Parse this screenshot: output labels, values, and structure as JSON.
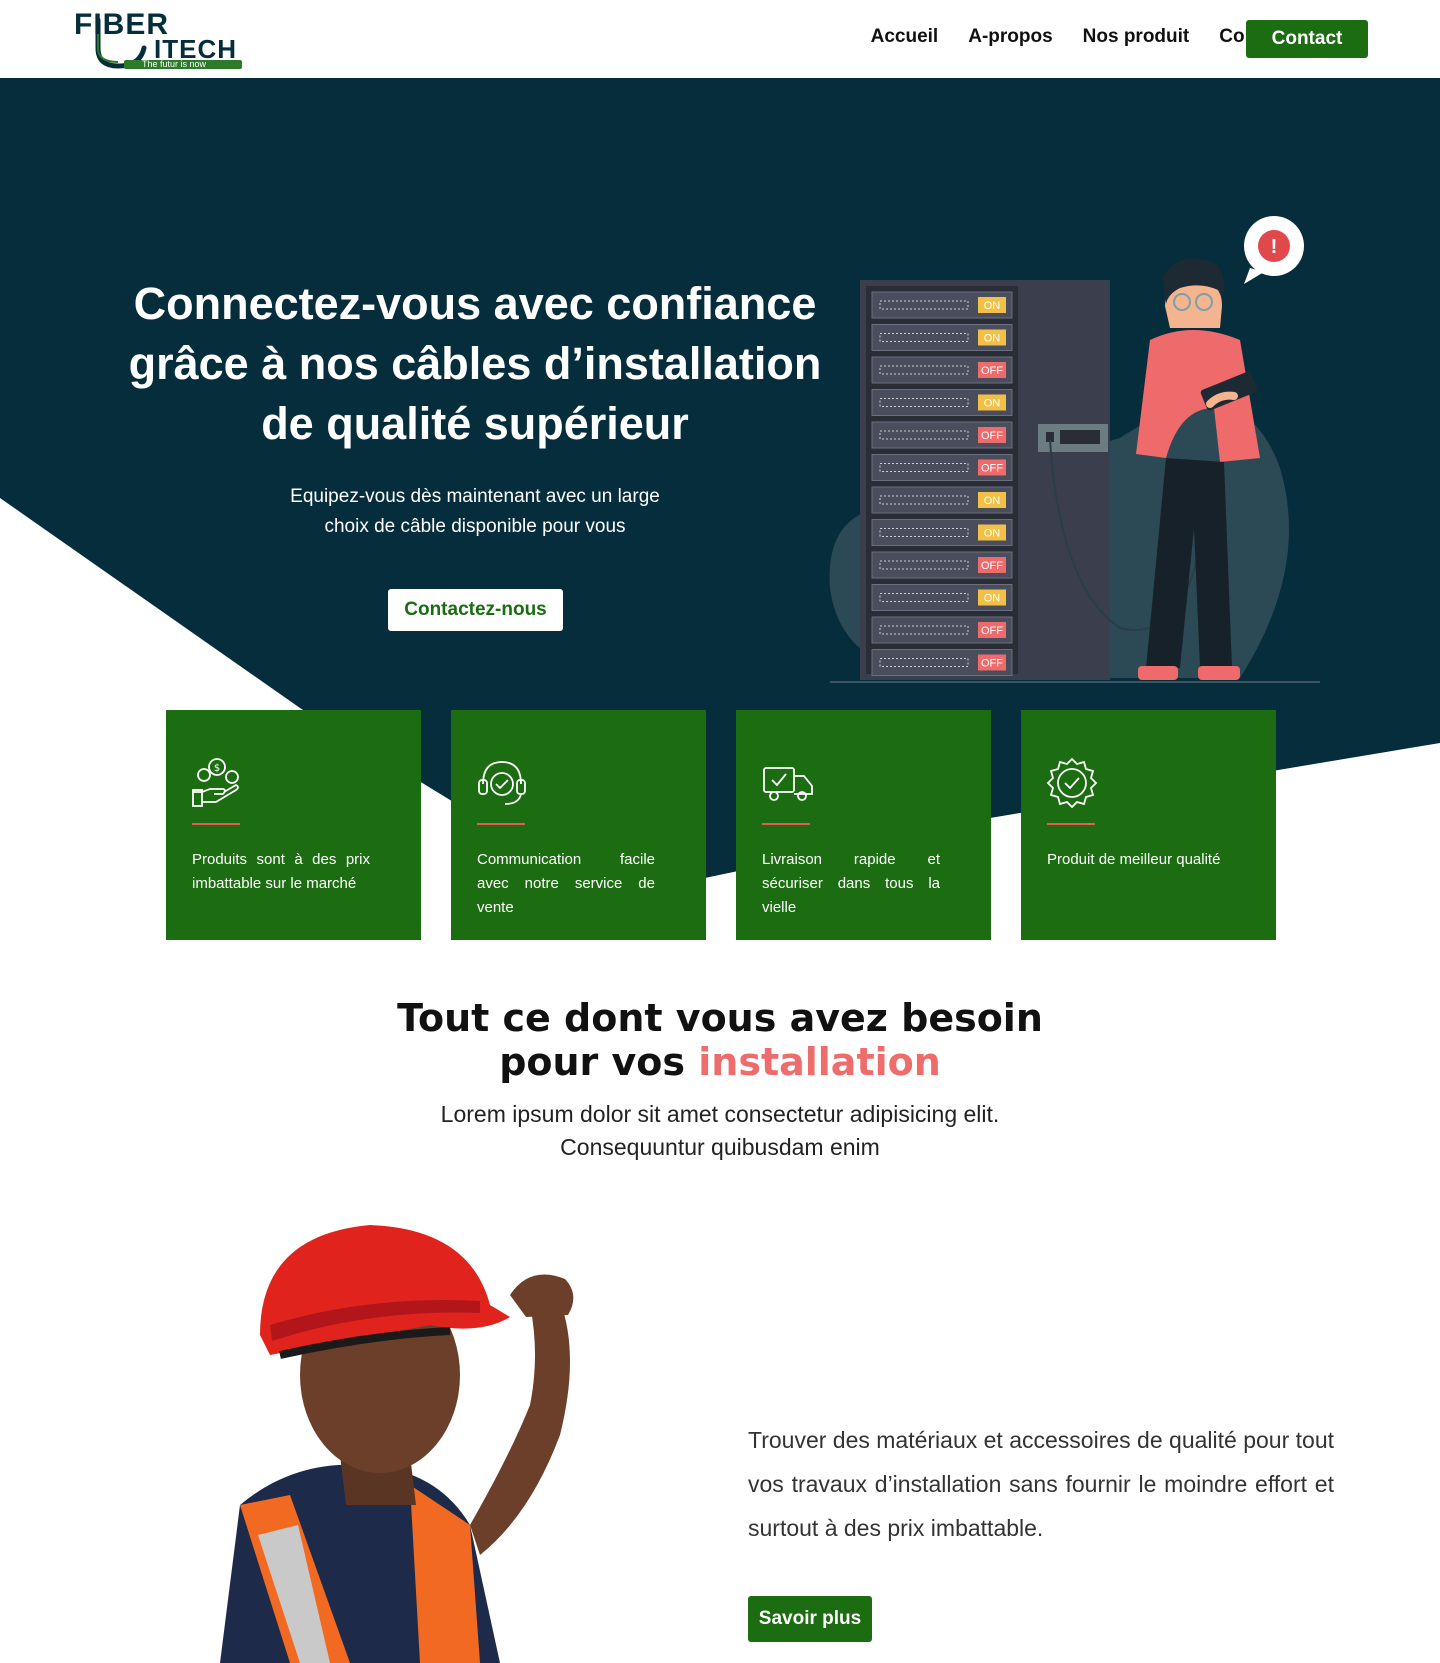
{
  "header": {
    "logo": {
      "word1": "FIBER",
      "word2": "ITECH",
      "tagline": "The futur is now"
    },
    "nav": [
      "Accueil",
      "A-propos",
      "Nos produit",
      "Contact"
    ],
    "cta": "Contact"
  },
  "hero": {
    "title": "Connectez-vous avec confiance grâce à nos câbles d’installation de qualité supérieur",
    "subtitle": "Equipez-vous dès maintenant avec un large choix de câble disponible pour vous",
    "button": "Contactez-nous",
    "illustration": {
      "rack_states": [
        "ON",
        "ON",
        "OFF",
        "ON",
        "OFF",
        "OFF",
        "ON",
        "ON",
        "OFF",
        "ON",
        "OFF",
        "OFF"
      ],
      "alert": "!"
    }
  },
  "features": [
    {
      "icon": "money-hand-icon",
      "text": "Produits sont à des prix imbattable sur le marché"
    },
    {
      "icon": "headset-support-icon",
      "text": "Communication facile avec notre service de vente"
    },
    {
      "icon": "delivery-truck-icon",
      "text": "Livraison rapide et sécuriser dans tous la vielle"
    },
    {
      "icon": "quality-badge-icon",
      "text": "Produit de meilleur qualité"
    }
  ],
  "section": {
    "title_line1": "Tout ce dont vous avez besoin",
    "title_line2_plain": "pour vos ",
    "title_line2_accent": "installation",
    "subtitle": "Lorem ipsum dolor sit amet consectetur adipisicing elit. Consequuntur quibusdam enim",
    "body": "Trouver des matériaux et accessoires de qualité pour tout vos travaux d’installation sans fournir le moindre effort et surtout à des prix imbattable.",
    "button": "Savoir plus"
  },
  "colors": {
    "brand_green": "#1c6d12",
    "hero_navy": "#052d3b",
    "accent_red": "#ee6c6c"
  }
}
